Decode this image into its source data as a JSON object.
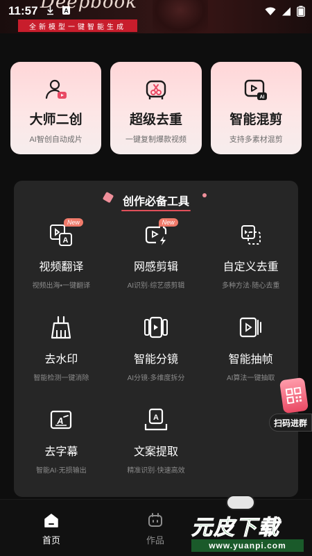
{
  "status_bar": {
    "time": "11:57",
    "left_icons": [
      "download-icon",
      "notification-a-icon"
    ],
    "right_icons": [
      "wifi-icon",
      "signal-icon",
      "battery-icon"
    ]
  },
  "banner": {
    "logo_text": "Deepbook",
    "tagline": "全新模型一键智能生成"
  },
  "top_cards": [
    {
      "title": "大师二创",
      "subtitle": "AI智创自动成片",
      "icon": "user-video-icon"
    },
    {
      "title": "超级去重",
      "subtitle": "一键复制爆款视频",
      "icon": "scissors-cut-icon"
    },
    {
      "title": "智能混剪",
      "subtitle": "支持多素材混剪",
      "icon": "ai-video-icon"
    }
  ],
  "tools_section": {
    "title": "创作必备工具",
    "items": [
      {
        "name": "视频翻译",
        "desc": "视频出海•一键翻译",
        "icon": "translate-icon",
        "badge": "New"
      },
      {
        "name": "网感剪辑",
        "desc": "AI识别·综艺感剪辑",
        "icon": "flash-video-icon",
        "badge": "New"
      },
      {
        "name": "自定义去重",
        "desc": "多种方法·随心去重",
        "icon": "custom-dedupe-icon",
        "badge": ""
      },
      {
        "name": "去水印",
        "desc": "智能检测一键消除",
        "icon": "broom-icon",
        "badge": ""
      },
      {
        "name": "智能分镜",
        "desc": "AI分镜·多维度拆分",
        "icon": "storyboard-icon",
        "badge": ""
      },
      {
        "name": "智能抽帧",
        "desc": "AI算法一键抽取",
        "icon": "frame-extract-icon",
        "badge": ""
      },
      {
        "name": "去字幕",
        "desc": "智能AI·无损输出",
        "icon": "remove-subtitle-icon",
        "badge": ""
      },
      {
        "name": "文案提取",
        "desc": "精准识别·快速高效",
        "icon": "text-extract-icon",
        "badge": ""
      }
    ]
  },
  "qr_float": {
    "label": "扫码进群"
  },
  "bottom_nav": {
    "items": [
      {
        "label": "首页",
        "icon": "home-icon",
        "active": true
      },
      {
        "label": "作品",
        "icon": "works-icon",
        "active": false
      }
    ]
  },
  "watermark": {
    "text": "元皮下载",
    "url": "www.yuanpi.com"
  },
  "colors": {
    "background": "#0e0e0e",
    "card_gradient_top": "#ffd6d8",
    "panel": "#262626",
    "accent_red": "#c81d2c",
    "badge": "#f07a6a"
  }
}
